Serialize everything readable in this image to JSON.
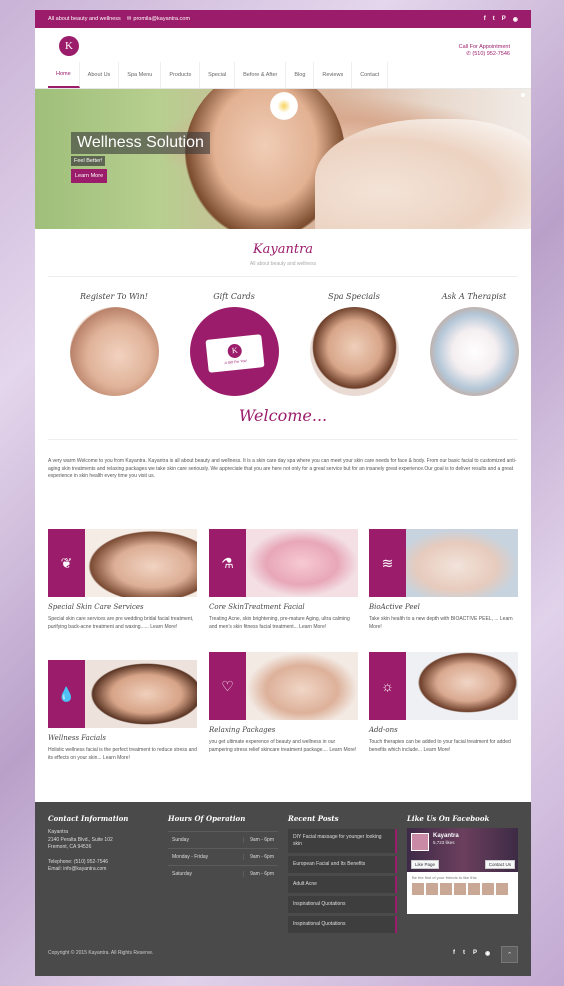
{
  "topbar": {
    "tagline": "All about beauty and wellness",
    "email": "promila@kayantra.com",
    "social": [
      "f",
      "t",
      "P",
      "rss"
    ]
  },
  "header": {
    "logo_letter": "K",
    "call_label": "Call For Appointment",
    "phone": "(510) 952-7546"
  },
  "nav": [
    "Home",
    "About Us",
    "Spa Menu",
    "Products",
    "Special",
    "Before & After",
    "Blog",
    "Reviews",
    "Contact"
  ],
  "hero": {
    "title": "Wellness Solution",
    "subtitle": "Feel Better!",
    "button": "Learn More"
  },
  "brand": {
    "name": "Kayantra",
    "tagline": "All about beauty and wellness"
  },
  "categories": [
    "Register To Win!",
    "Gift Cards",
    "Spa Specials",
    "Ask A Therapist"
  ],
  "gift_card": {
    "letter": "K",
    "caption": "A Gift For You!"
  },
  "welcome": {
    "heading": "Welcome...",
    "text": "A very warm Welcome to you from Kayantra. Kayantra is all about beauty and wellness. It is a skin care day spa where you can meet your skin care needs for face & body. From our basic facial to customized anti-aging skin treatments and relaxing packages we take skin care seriously. We appreciate that you are here not only for a great service but for an insanely great experience.Our goal is to deliver results and a great experience in skin health every time you visit us."
  },
  "services": [
    {
      "title": "Special Skin Care Services",
      "icon": "leaf-icon",
      "text": "Special skin care services are pre wedding bridal facial treatment, purifying back-acne treatment and waxing...... Learn More!"
    },
    {
      "title": "Core SkinTreatment Facial",
      "icon": "flask-icon",
      "text": "Treating Acne, skin brightening, pre-mature Aging, ultra calming and men's skin fitness facial treatment... Learn More!"
    },
    {
      "title": "BioActive Peel",
      "icon": "waves-icon",
      "text": "Take skin health to a new depth with BIOACTIVE PEEL, ... Learn More!"
    },
    {
      "title": "Wellness Facials",
      "icon": "drop-icon",
      "text": "Holistic wellness facial is the perfect treatment to reduce stress and its effects on your skin... Learn More!"
    },
    {
      "title": "Relaxing Packages",
      "icon": "heart-icon",
      "text": "you get ultimate experence of beauty and wellness in our pampering stress relief skincare treatment package.... Learn More!"
    },
    {
      "title": "Add-ons",
      "icon": "sun-icon",
      "text": "Touch therapies can be added to your facial treatment for added benefits which include... Learn More!"
    }
  ],
  "footer": {
    "contact": {
      "heading": "Contact Information",
      "name": "Kayantra",
      "addr1": "2140 Peralta Blvd., Suite 102",
      "addr2": "Fremont, CA 94536",
      "telephone": "Telephone: (510) 952-7546",
      "email": "Email: info@kayantra.com"
    },
    "hours": {
      "heading": "Hours Of Operation",
      "rows": [
        {
          "day": "Sunday",
          "time": "9am - 6pm"
        },
        {
          "day": "Monday - Friday",
          "time": "9am - 6pm"
        },
        {
          "day": "Saturday",
          "time": "9am - 6pm"
        }
      ]
    },
    "posts": {
      "heading": "Recent Posts",
      "items": [
        "DIY Facial massage for younger looking skin",
        "European Facial and Its Benefits",
        "Adult Acne",
        "Inspirational Quotations",
        "Inspirational Quotations"
      ]
    },
    "facebook": {
      "heading": "Like Us On Facebook",
      "page": "Kayantra",
      "likes": "5,723 likes",
      "like_btn": "Like Page",
      "contact_btn": "Contact Us",
      "friends": "Be the first of your friends to like this"
    },
    "copyright": "Copyright © 2015 Kayantra. All Rights Reserve.",
    "social": [
      "f",
      "t",
      "P",
      "rss"
    ]
  },
  "colors": {
    "brand": "#9b1c6a",
    "footer": "#4a4a4a"
  }
}
